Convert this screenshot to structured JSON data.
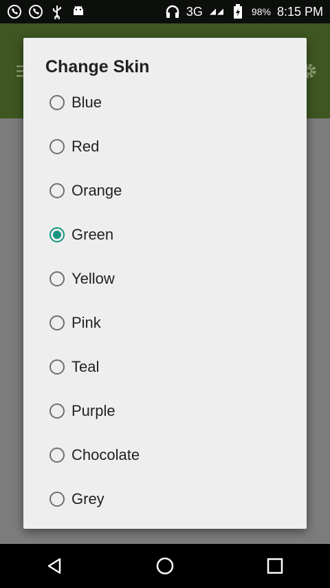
{
  "status_bar": {
    "network": "3G",
    "battery": "98%",
    "time": "8:15 PM",
    "icons": [
      "phone-icon",
      "phone-icon",
      "usb-icon",
      "android-icon",
      "headset-icon",
      "signal-icon",
      "battery-charging-icon"
    ]
  },
  "dialog": {
    "title": "Change Skin",
    "options": [
      {
        "label": "Blue",
        "selected": false
      },
      {
        "label": "Red",
        "selected": false
      },
      {
        "label": "Orange",
        "selected": false
      },
      {
        "label": "Green",
        "selected": true
      },
      {
        "label": "Yellow",
        "selected": false
      },
      {
        "label": "Pink",
        "selected": false
      },
      {
        "label": "Teal",
        "selected": false
      },
      {
        "label": "Purple",
        "selected": false
      },
      {
        "label": "Chocolate",
        "selected": false
      },
      {
        "label": "Grey",
        "selected": false
      }
    ]
  },
  "colors": {
    "accent": "#15957f",
    "app_bar": "#3e5621",
    "dialog_bg": "#eeeeee"
  },
  "navigation": {
    "icons": [
      "back-icon",
      "home-icon",
      "recents-icon"
    ]
  }
}
